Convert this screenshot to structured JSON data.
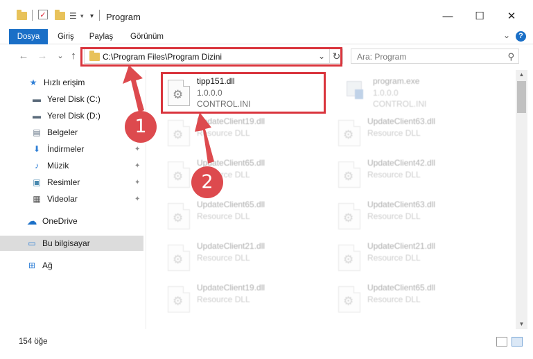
{
  "window": {
    "title": "Program",
    "minimize_glyph": "—",
    "maximize_glyph": "☐",
    "close_glyph": "✕"
  },
  "ribbon": {
    "tabs": [
      {
        "label": "Dosya",
        "active": true
      },
      {
        "label": "Giriş",
        "active": false
      },
      {
        "label": "Paylaş",
        "active": false
      },
      {
        "label": "Görünüm",
        "active": false
      }
    ],
    "expand_glyph": "⌄",
    "help_glyph": "?"
  },
  "address": {
    "back_glyph": "←",
    "forward_glyph": "→",
    "recent_glyph": "⌄",
    "up_glyph": "↑",
    "path": "C:\\Program Files\\Program Dizini",
    "dropdown_glyph": "⌄",
    "refresh_glyph": "↻"
  },
  "search": {
    "placeholder": "Ara: Program",
    "icon_glyph": "⚲"
  },
  "nav_pane": {
    "items": [
      {
        "label": "Hızlı erişim",
        "icon": "star-icon",
        "glyph": "★",
        "color": "#2f7fd6"
      },
      {
        "label": "Yerel Disk (C:)",
        "icon": "drive-icon",
        "glyph": "▬",
        "color": "#5a6a7a"
      },
      {
        "label": "Yerel Disk (D:)",
        "icon": "drive-icon",
        "glyph": "▬",
        "color": "#5a6a7a"
      },
      {
        "label": "Belgeler",
        "icon": "documents-icon",
        "glyph": "▤",
        "color": "#6a7a8a"
      },
      {
        "label": "İndirmeler",
        "icon": "download-icon",
        "glyph": "⬇",
        "color": "#2f7fd6"
      },
      {
        "label": "Müzik",
        "icon": "music-icon",
        "glyph": "♪",
        "color": "#2f7fd6"
      },
      {
        "label": "Resimler",
        "icon": "pictures-icon",
        "glyph": "▣",
        "color": "#4a8ab0"
      },
      {
        "label": "Videolar",
        "icon": "videos-icon",
        "glyph": "▦",
        "color": "#555555"
      },
      {
        "label": "OneDrive",
        "icon": "cloud-icon",
        "glyph": "☁",
        "color": "#1a6fc7"
      },
      {
        "label": "Bu bilgisayar",
        "icon": "computer-icon",
        "glyph": "▭",
        "color": "#2f7fd6"
      },
      {
        "label": "Ağ",
        "icon": "network-icon",
        "glyph": "⊞",
        "color": "#2f7fd6"
      }
    ],
    "pin_glyph": "📌"
  },
  "files": {
    "highlighted": {
      "name": "tipp151.dll",
      "version": "1.0.0.0",
      "desc": "CONTROL.INI"
    },
    "exe": {
      "name": "program.exe",
      "version": "1.0.0.0",
      "desc": "CONTROL.INI"
    },
    "left_column": [
      {
        "name": "UpdateClient19.dll",
        "desc": "Resource DLL"
      },
      {
        "name": "UpdateClient65.dll",
        "desc": "Resource DLL"
      },
      {
        "name": "UpdateClient65.dll",
        "desc": "Resource DLL"
      },
      {
        "name": "UpdateClient21.dll",
        "desc": "Resource DLL"
      },
      {
        "name": "UpdateClient19.dll",
        "desc": "Resource DLL"
      }
    ],
    "right_column": [
      {
        "name": "UpdateClient63.dll",
        "desc": "Resource DLL"
      },
      {
        "name": "UpdateClient42.dll",
        "desc": "Resource DLL"
      },
      {
        "name": "UpdateClient63.dll",
        "desc": "Resource DLL"
      },
      {
        "name": "UpdateClient21.dll",
        "desc": "Resource DLL"
      },
      {
        "name": "UpdateClient65.dll",
        "desc": "Resource DLL"
      }
    ],
    "gear_glyph": "⚙"
  },
  "status": {
    "item_count": "154 öğe"
  },
  "markers": {
    "step1": "1",
    "step2": "2",
    "color": "#dd4a4e"
  },
  "scroll": {
    "up_glyph": "▲",
    "down_glyph": "▼"
  }
}
